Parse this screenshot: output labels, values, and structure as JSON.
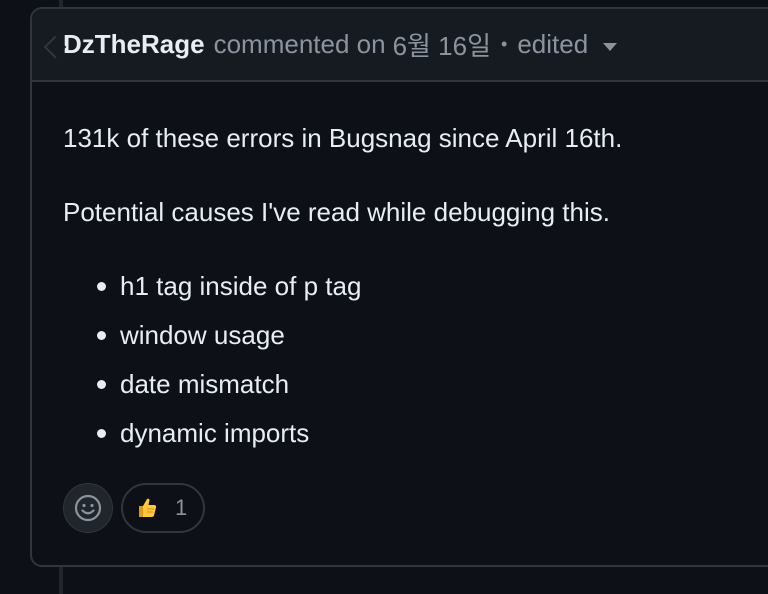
{
  "comment": {
    "author": "DzTheRage",
    "action": "commented on",
    "date": "6월 16일",
    "separator": "•",
    "edited_label": "edited",
    "body": {
      "paragraphs": [
        "131k of these errors in Bugsnag since April 16th.",
        "Potential causes I've read while debugging this."
      ],
      "list_items": [
        "h1 tag inside of p tag",
        "window usage",
        "date mismatch",
        "dynamic imports"
      ]
    },
    "reactions": {
      "picker_icon": "smiley-icon",
      "items": [
        {
          "icon": "thumbs-up-icon",
          "count": "1"
        }
      ]
    }
  },
  "colors": {
    "background": "#0d1117",
    "header_background": "#161b22",
    "border": "#30363d",
    "text": "#e6edf3",
    "muted_text": "#8b949e"
  }
}
